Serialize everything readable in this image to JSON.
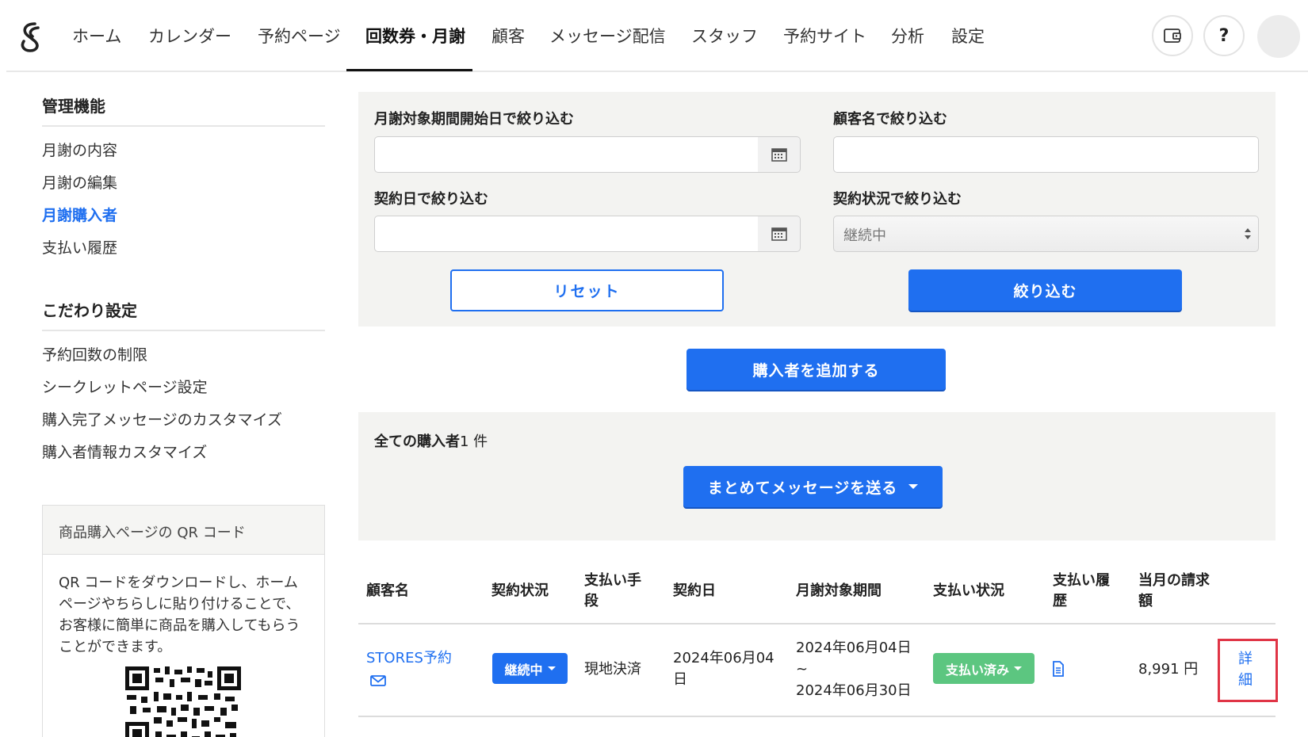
{
  "nav": {
    "items": [
      "ホーム",
      "カレンダー",
      "予約ページ",
      "回数券・月謝",
      "顧客",
      "メッセージ配信",
      "スタッフ",
      "予約サイト",
      "分析",
      "設定"
    ],
    "help_label": "?"
  },
  "sidebar": {
    "section1_title": "管理機能",
    "section1_items": [
      "月謝の内容",
      "月謝の編集",
      "月謝購入者",
      "支払い履歴"
    ],
    "section2_title": "こだわり設定",
    "section2_items": [
      "予約回数の制限",
      "シークレットページ設定",
      "購入完了メッセージのカスタマイズ",
      "購入者情報カスタマイズ"
    ],
    "qr_title": "商品購入ページの QR コード",
    "qr_description": "QR コードをダウンロードし、ホームページやちらしに貼り付けることで、お客様に簡単に商品を購入してもらうことができます。"
  },
  "filters": {
    "period_label": "月謝対象期間開始日で絞り込む",
    "customer_label": "顧客名で絞り込む",
    "contract_date_label": "契約日で絞り込む",
    "status_label": "契約状況で絞り込む",
    "status_value": "継続中",
    "reset_label": "リセット",
    "apply_label": "絞り込む"
  },
  "add_buyer_label": "購入者を追加する",
  "buyers": {
    "all_label": "全ての購入者",
    "count_text": "1 件",
    "bulk_message_label": "まとめてメッセージを送る"
  },
  "table": {
    "headers": [
      "顧客名",
      "契約状況",
      "支払い手段",
      "契約日",
      "月謝対象期間",
      "支払い状況",
      "支払い履歴",
      "当月の請求額"
    ],
    "rows": [
      {
        "customer": "STORES予約",
        "contract_status": "継続中",
        "payment_method": "現地決済",
        "contract_date": "2024年06月04日",
        "period_start": "2024年06月04日",
        "period_sep": "~",
        "period_end": "2024年06月30日",
        "payment_status": "支払い済み",
        "amount": "8,991 円",
        "detail_label": "詳細"
      }
    ]
  },
  "colors": {
    "accent": "#1f6ff0",
    "paid_green": "#5cc680",
    "highlight_red": "#e03546"
  }
}
